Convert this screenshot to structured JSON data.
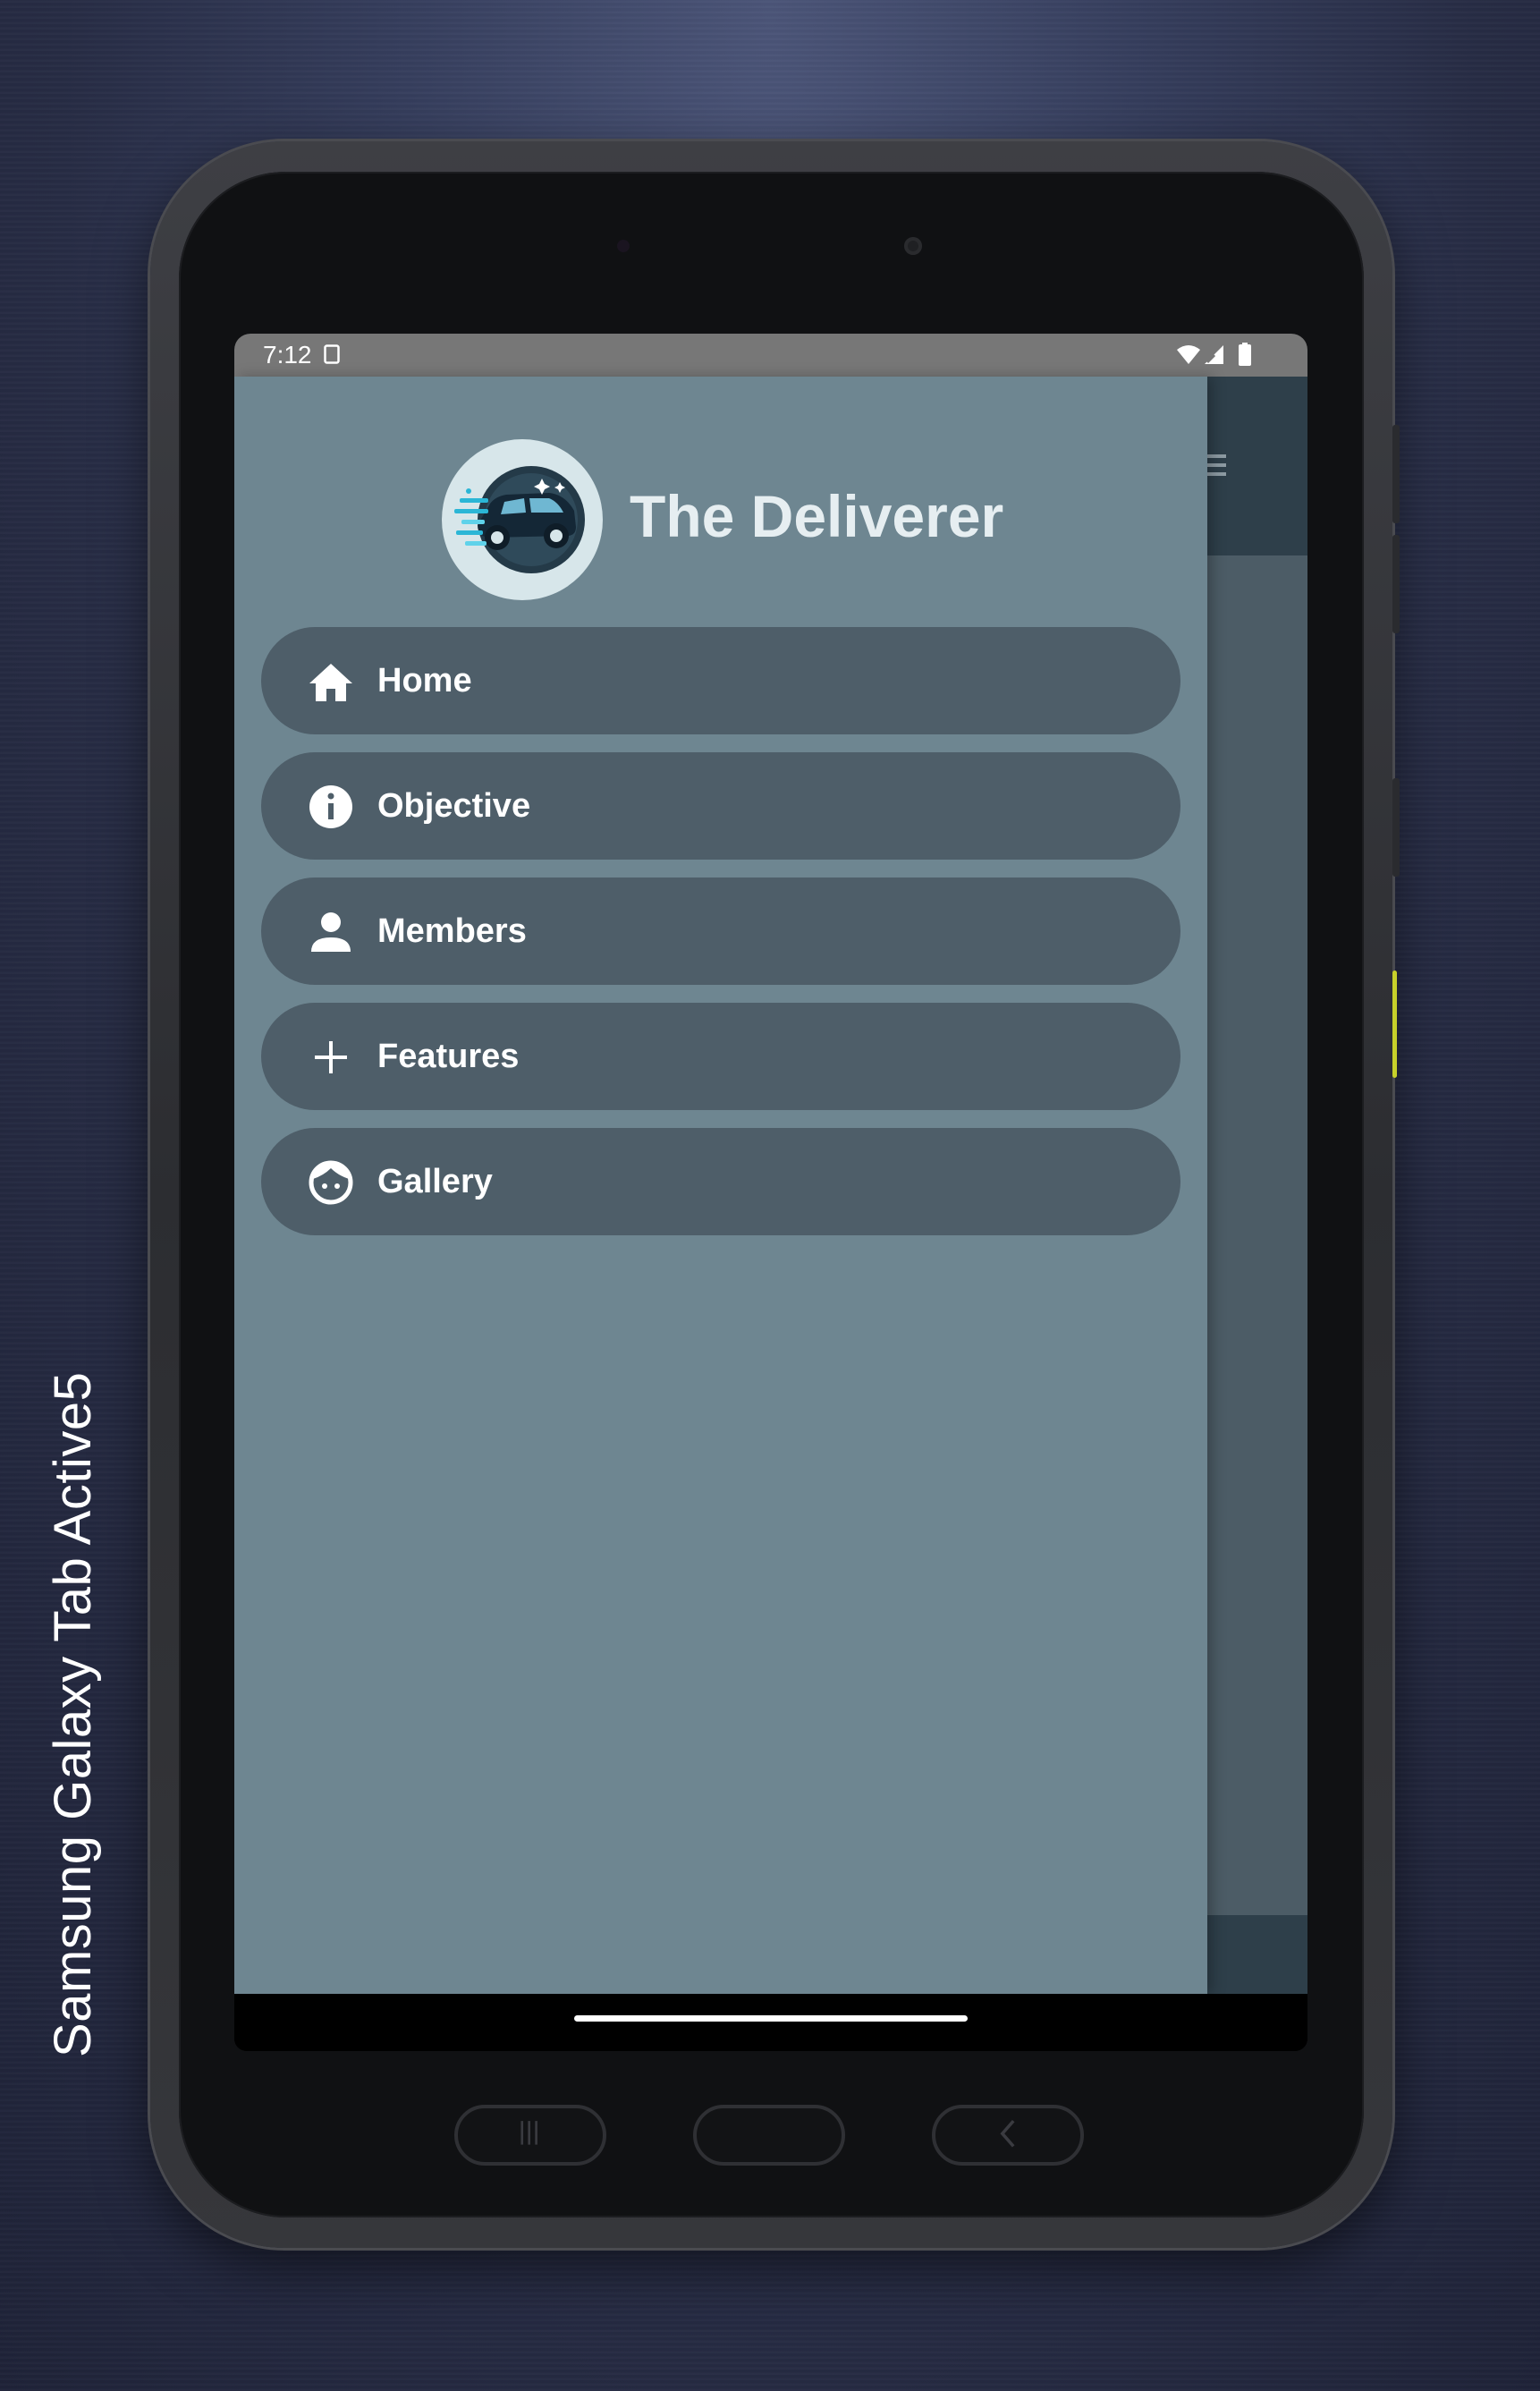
{
  "device": {
    "label": "Samsung Galaxy  Tab Active5"
  },
  "status_bar": {
    "time": "7:12",
    "icons": [
      "screenshot-icon",
      "wifi-icon",
      "signal-icon",
      "battery-icon"
    ]
  },
  "drawer": {
    "app_title": "The Deliverer",
    "logo": "delivery-car-logo",
    "items": [
      {
        "label": "Home",
        "icon": "home-icon"
      },
      {
        "label": "Objective",
        "icon": "info-icon"
      },
      {
        "label": "Members",
        "icon": "person-icon"
      },
      {
        "label": "Features",
        "icon": "plus-icon"
      },
      {
        "label": "Gallery",
        "icon": "face-icon"
      }
    ]
  },
  "colors": {
    "drawer_background": "#6e8691",
    "nav_item_background": "#4e5e69",
    "toolbar": "#2e3f4a",
    "status_bar": "#777777",
    "title_text": "#e6eef1"
  }
}
